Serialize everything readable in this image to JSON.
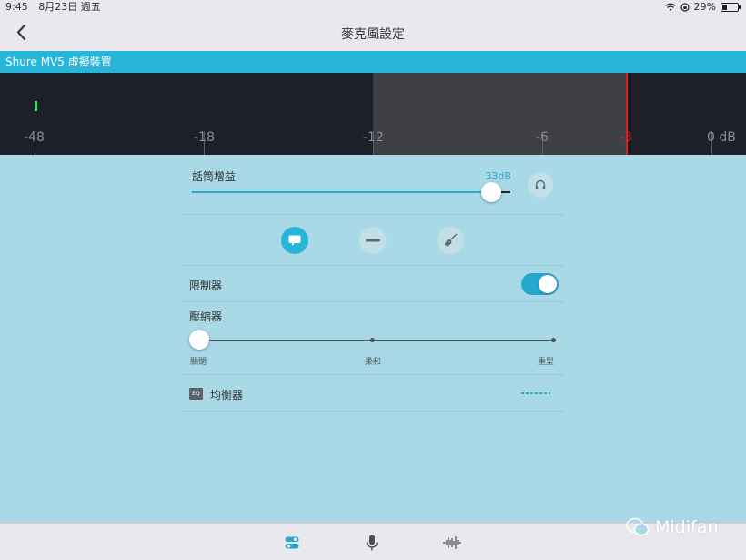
{
  "status": {
    "time": "9:45",
    "date": "8月23日 週五",
    "battery": "29%",
    "battery_level": 0.29
  },
  "nav": {
    "title": "麥克風設定"
  },
  "device": {
    "name": "Shure MV5 虛擬裝置"
  },
  "meter": {
    "ticks": [
      "-48",
      "-18",
      "-12",
      "-6",
      "-3",
      "0 dB"
    ],
    "clip_label": "-3",
    "colors": {
      "background": "#1d2029",
      "level": "#3fe04a",
      "clip": "#d21f1f"
    }
  },
  "gain": {
    "label": "話筒增益",
    "value": "33dB",
    "fraction": 0.94
  },
  "modes": {
    "selected": "speech",
    "items": [
      "speech-bubble-icon",
      "flat-icon",
      "guitar-icon"
    ]
  },
  "limiter": {
    "label": "限制器",
    "enabled": true
  },
  "compressor": {
    "label": "壓縮器",
    "stops": [
      "關閉",
      "柔和",
      "重型"
    ],
    "selected": "關閉"
  },
  "eq": {
    "badge": "EQ",
    "label": "均衡器"
  },
  "tabs": [
    "settings-toggle-icon",
    "microphone-icon",
    "waveform-icon"
  ],
  "watermark": {
    "text": "Midifan"
  },
  "colors": {
    "accent": "#27b5d9",
    "content_background": "#a9d8e6",
    "bar_background": "#e9e9ed"
  }
}
